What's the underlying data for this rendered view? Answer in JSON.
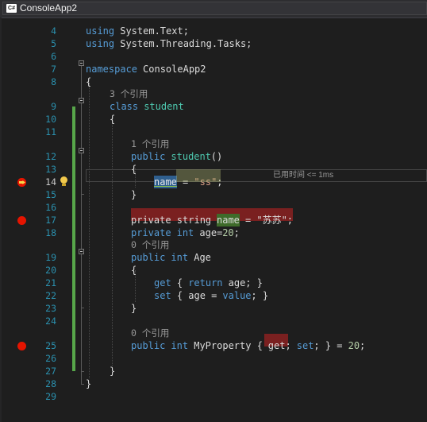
{
  "tab": {
    "icon": "C#",
    "title": "ConsoleApp2"
  },
  "perf_tip": "已用时间 <= 1ms",
  "lines": [
    {
      "n": "4",
      "tokens": [
        {
          "t": "using",
          "c": "kw"
        },
        {
          "t": " System.Text;",
          "c": "plain"
        }
      ]
    },
    {
      "n": "5",
      "tokens": [
        {
          "t": "using",
          "c": "kw"
        },
        {
          "t": " System.Threading.Tasks;",
          "c": "plain"
        }
      ]
    },
    {
      "n": "6",
      "tokens": []
    },
    {
      "n": "7",
      "tokens": [
        {
          "t": "namespace",
          "c": "kw"
        },
        {
          "t": " ConsoleApp2",
          "c": "plain"
        }
      ]
    },
    {
      "n": "8",
      "tokens": [
        {
          "t": "{",
          "c": "plain"
        }
      ]
    },
    {
      "n": "9",
      "lens": "3 个引用",
      "tokens": [
        {
          "t": "class",
          "c": "kw"
        },
        {
          "t": " ",
          "c": "plain"
        },
        {
          "t": "student",
          "c": "typ"
        }
      ]
    },
    {
      "n": "10",
      "tokens": [
        {
          "t": "{",
          "c": "plain"
        }
      ]
    },
    {
      "n": "11",
      "tokens": []
    },
    {
      "n": "12",
      "lens": "1 个引用",
      "tokens": [
        {
          "t": "public",
          "c": "kw"
        },
        {
          "t": " ",
          "c": "plain"
        },
        {
          "t": "student",
          "c": "typ"
        },
        {
          "t": "()",
          "c": "plain"
        }
      ]
    },
    {
      "n": "13",
      "tokens": [
        {
          "t": "{",
          "c": "plain"
        }
      ]
    },
    {
      "n": "14",
      "tokens": [
        {
          "t": "name",
          "c": "sel"
        },
        {
          "t": " = ",
          "c": "plain"
        },
        {
          "t": "\"ss\"",
          "c": "str"
        },
        {
          "t": ";",
          "c": "plain"
        }
      ]
    },
    {
      "n": "15",
      "tokens": [
        {
          "t": "}",
          "c": "plain"
        }
      ]
    },
    {
      "n": "16",
      "tokens": []
    },
    {
      "n": "17",
      "tokens": [
        {
          "t": "private string ",
          "c": "plain"
        },
        {
          "t": "name",
          "c": "ref"
        },
        {
          "t": " = ",
          "c": "plain"
        },
        {
          "t": "\"苏苏\"",
          "c": "plain"
        },
        {
          "t": ";",
          "c": "plain"
        }
      ]
    },
    {
      "n": "18",
      "tokens": [
        {
          "t": "private",
          "c": "kw"
        },
        {
          "t": " ",
          "c": "plain"
        },
        {
          "t": "int",
          "c": "kw"
        },
        {
          "t": " age=",
          "c": "plain"
        },
        {
          "t": "20",
          "c": "num"
        },
        {
          "t": ";",
          "c": "plain"
        }
      ]
    },
    {
      "n": "19",
      "lens": "0 个引用",
      "tokens": [
        {
          "t": "public",
          "c": "kw"
        },
        {
          "t": " ",
          "c": "plain"
        },
        {
          "t": "int",
          "c": "kw"
        },
        {
          "t": " Age",
          "c": "plain"
        }
      ]
    },
    {
      "n": "20",
      "tokens": [
        {
          "t": "{",
          "c": "plain"
        }
      ]
    },
    {
      "n": "21",
      "tokens": [
        {
          "t": "get",
          "c": "kw"
        },
        {
          "t": " { ",
          "c": "plain"
        },
        {
          "t": "return",
          "c": "kw"
        },
        {
          "t": " age; }",
          "c": "plain"
        }
      ]
    },
    {
      "n": "22",
      "tokens": [
        {
          "t": "set",
          "c": "kw"
        },
        {
          "t": " { age = ",
          "c": "plain"
        },
        {
          "t": "value",
          "c": "kw"
        },
        {
          "t": "; }",
          "c": "plain"
        }
      ]
    },
    {
      "n": "23",
      "tokens": [
        {
          "t": "}",
          "c": "plain"
        }
      ]
    },
    {
      "n": "24",
      "tokens": []
    },
    {
      "n": "25",
      "lens": "0 个引用",
      "tokens": [
        {
          "t": "public",
          "c": "kw"
        },
        {
          "t": " ",
          "c": "plain"
        },
        {
          "t": "int",
          "c": "kw"
        },
        {
          "t": " MyProperty { ",
          "c": "plain"
        },
        {
          "t": "get;",
          "c": "bpkw"
        },
        {
          "t": " ",
          "c": "plain"
        },
        {
          "t": "set",
          "c": "kw"
        },
        {
          "t": "; } = ",
          "c": "plain"
        },
        {
          "t": "20",
          "c": "num"
        },
        {
          "t": ";",
          "c": "plain"
        }
      ]
    },
    {
      "n": "26",
      "tokens": []
    },
    {
      "n": "27",
      "tokens": [
        {
          "t": "}",
          "c": "plain"
        }
      ]
    },
    {
      "n": "28",
      "tokens": [
        {
          "t": "}",
          "c": "plain"
        }
      ]
    },
    {
      "n": "29",
      "tokens": []
    }
  ]
}
